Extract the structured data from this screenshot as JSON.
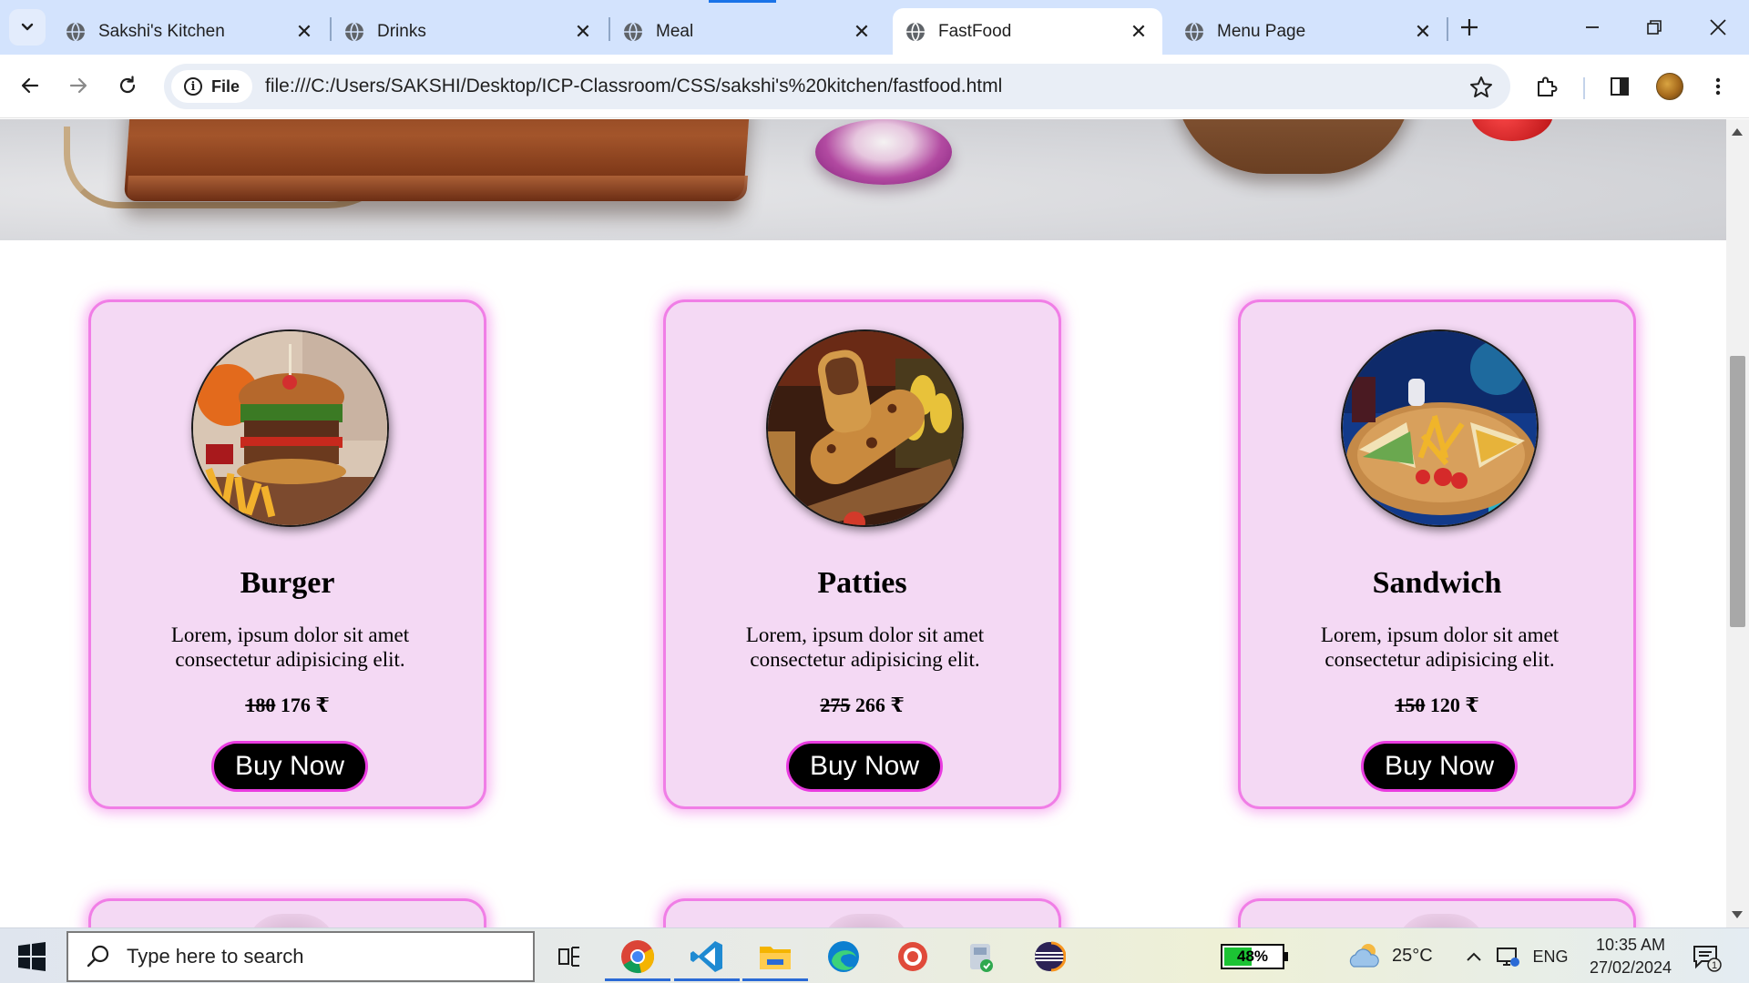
{
  "browser": {
    "tabs": [
      {
        "label": "Sakshi's Kitchen",
        "active": false
      },
      {
        "label": "Drinks",
        "active": false
      },
      {
        "label": "Meal",
        "active": false
      },
      {
        "label": "FastFood",
        "active": true
      },
      {
        "label": "Menu Page",
        "active": false
      }
    ],
    "site_chip": "File",
    "url": "file:///C:/Users/SAKSHI/Desktop/ICP-Classroom/CSS/sakshi's%20kitchen/fastfood.html"
  },
  "page": {
    "products": [
      {
        "name": "Burger",
        "description": "Lorem, ipsum dolor sit amet consectetur adipisicing elit.",
        "old_price": "180",
        "new_price": "176 ₹",
        "button": "Buy Now"
      },
      {
        "name": "Patties",
        "description": "Lorem, ipsum dolor sit amet consectetur adipisicing elit.",
        "old_price": "275",
        "new_price": "266 ₹",
        "button": "Buy Now"
      },
      {
        "name": "Sandwich",
        "description": "Lorem, ipsum dolor sit amet consectetur adipisicing elit.",
        "old_price": "150",
        "new_price": "120 ₹",
        "button": "Buy Now"
      }
    ]
  },
  "taskbar": {
    "search_placeholder": "Type here to search",
    "battery": "48%",
    "battery_level": 0.48,
    "weather": "25°C",
    "language": "ENG",
    "time": "10:35 AM",
    "date": "27/02/2024",
    "notification_count": "1"
  },
  "colors": {
    "card_background": "#f4d9f4",
    "card_border": "#f07ee6",
    "button_background": "#000000",
    "button_border": "#e93be0",
    "tabstrip": "#d3e3fd"
  }
}
